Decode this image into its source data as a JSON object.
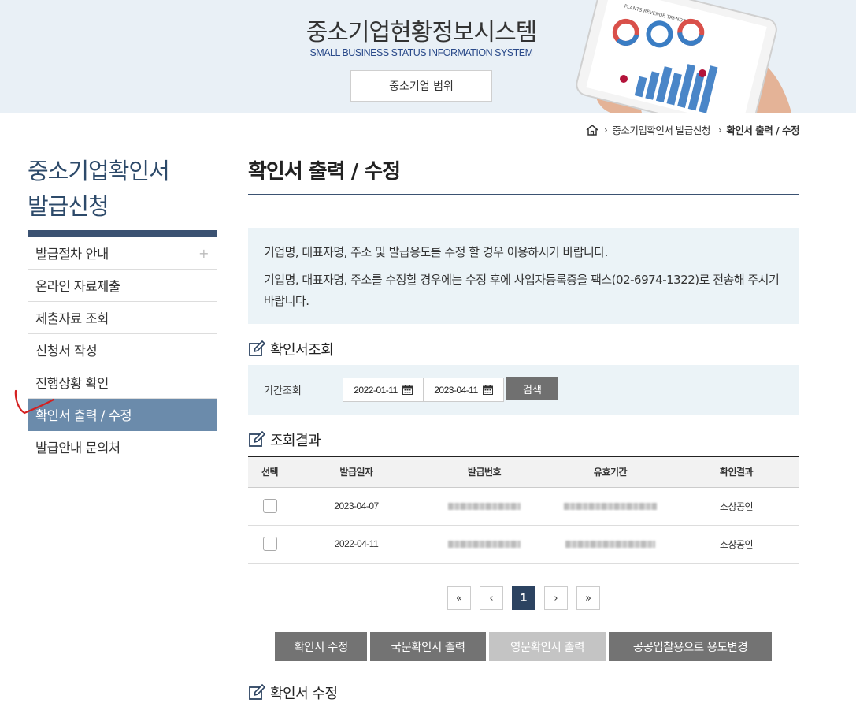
{
  "banner": {
    "title": "중소기업현황정보시스템",
    "subtitle": "SMALL BUSINESS STATUS INFORMATION SYSTEM",
    "scope_button": "중소기업 범위",
    "tablet_caption": "PLANTS REVENUE TRENDS"
  },
  "breadcrumb": {
    "items": [
      "중소기업확인서 발급신청",
      "확인서 출력 / 수정"
    ]
  },
  "sidebar": {
    "title_line1": "중소기업확인서",
    "title_line2": "발급신청",
    "items": [
      {
        "label": "발급절차 안내",
        "plus": "+"
      },
      {
        "label": "온라인 자료제출"
      },
      {
        "label": "제출자료 조회"
      },
      {
        "label": "신청서 작성"
      },
      {
        "label": "진행상황 확인"
      },
      {
        "label": "확인서 출력 / 수정",
        "active": true
      },
      {
        "label": "발급안내 문의처"
      }
    ]
  },
  "main": {
    "page_title": "확인서 출력 / 수정",
    "notice": {
      "line1": "기업명, 대표자명, 주소 및 발급용도를 수정 할 경우 이용하시기 바랍니다.",
      "line2": "기업명, 대표자명, 주소를 수정할 경우에는 수정 후에 사업자등록증을 팩스(02-6974-1322)로 전송해 주시기 바랍니다."
    },
    "search_section_title": "확인서조회",
    "search": {
      "label": "기간조회",
      "start_date": "2022-01-11",
      "end_date": "2023-04-11",
      "button": "검색"
    },
    "results_section_title": "조회결과",
    "table": {
      "headers": [
        "선택",
        "발급일자",
        "발급번호",
        "유효기간",
        "확인결과"
      ],
      "rows": [
        {
          "date": "2023-04-07",
          "result": "소상공인"
        },
        {
          "date": "2022-04-11",
          "result": "소상공인"
        }
      ]
    },
    "pagination": {
      "first": "«",
      "prev": "‹",
      "current": "1",
      "next": "›",
      "last": "»"
    },
    "actions": {
      "edit": "확인서 수정",
      "print_kr": "국문확인서 출력",
      "print_en": "영문확인서 출력",
      "change_purpose": "공공입찰용으로 용도변경"
    },
    "edit_section_title": "확인서 수정"
  },
  "colors": {
    "banner_bg": "#e9f0f6",
    "sidebar_accent": "#3b5272",
    "active_menu": "#6b8bab",
    "notice_bg": "#ebf3f7",
    "button_gray": "#737373",
    "page_active": "#2c4361"
  }
}
